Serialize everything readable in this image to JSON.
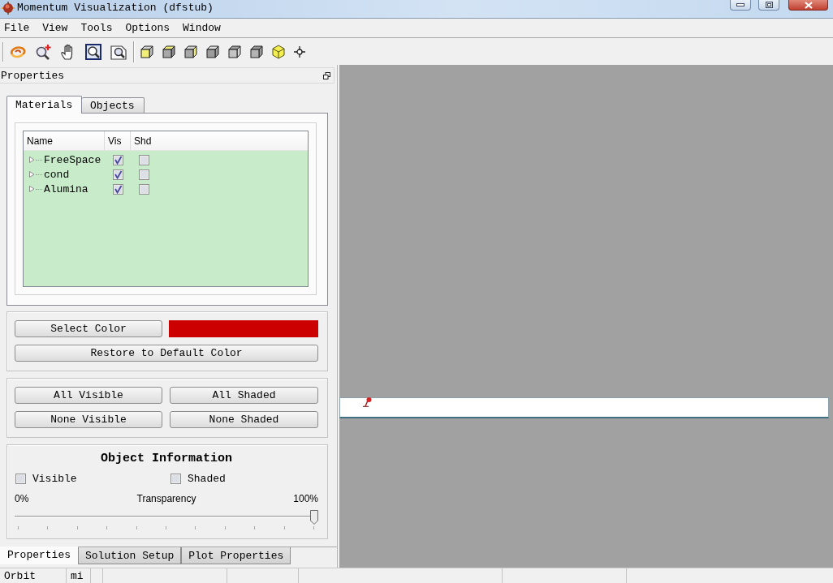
{
  "window": {
    "title": "Momentum Visualization (dfstub)"
  },
  "menu": [
    {
      "label": "File"
    },
    {
      "label": "View"
    },
    {
      "label": "Tools"
    },
    {
      "label": "Options"
    },
    {
      "label": "Window"
    }
  ],
  "properties_panel": {
    "title": "Properties",
    "tabs": [
      {
        "label": "Materials",
        "selected": true
      },
      {
        "label": "Objects",
        "selected": false
      }
    ],
    "materials": {
      "columns": [
        "Name",
        "Vis",
        "Shd"
      ],
      "rows": [
        {
          "name": "FreeSpace",
          "expanded": false,
          "vis": true,
          "shd": false
        },
        {
          "name": "cond",
          "expanded": false,
          "vis": true,
          "shd": false
        },
        {
          "name": "Alumina",
          "expanded": false,
          "vis": true,
          "shd": false
        }
      ]
    },
    "color_picker": {
      "button": "Select Color",
      "swatch": {
        "color": "#cc0000"
      },
      "restore_button": "Restore to Default Color"
    },
    "visibility_buttons": [
      "All Visible",
      "All Shaded",
      "None Visible",
      "None Shaded"
    ],
    "object_information": {
      "title": "Object Information",
      "visible": {
        "label": "Visible",
        "checked": false
      },
      "shaded": {
        "label": "Shaded",
        "checked": false
      },
      "transparency": {
        "label": "Transparency",
        "min_label": "0%",
        "max_label": "100%",
        "level": 1
      }
    }
  },
  "dock_tabs": [
    {
      "label": "Properties",
      "selected": true
    },
    {
      "label": "Solution Setup",
      "selected": false
    },
    {
      "label": "Plot Properties",
      "selected": false
    }
  ],
  "status_bar": [
    "Orbit",
    "mi"
  ]
}
